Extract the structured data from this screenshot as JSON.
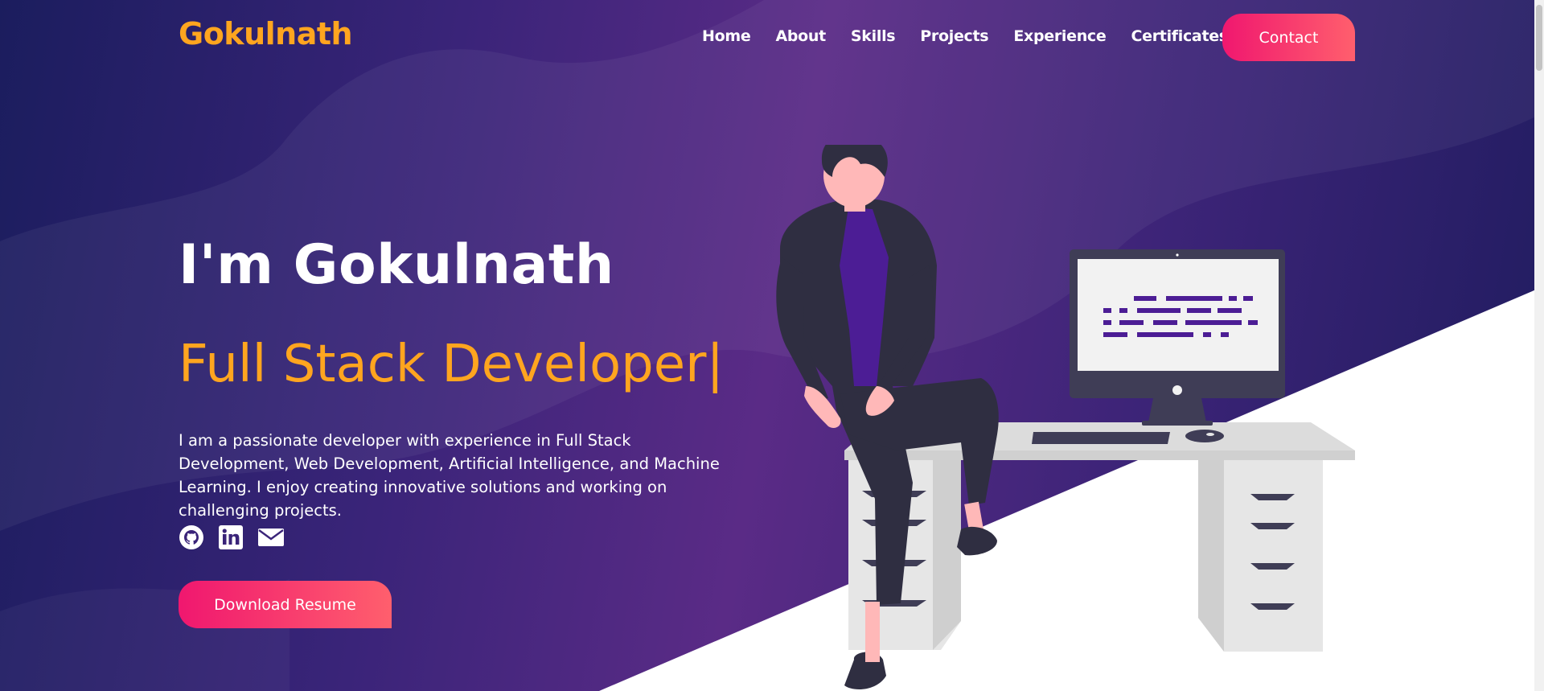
{
  "nav": {
    "brand": "Gokulnath",
    "links": [
      "Home",
      "About",
      "Skills",
      "Projects",
      "Experience",
      "Certificates"
    ],
    "contact_label": "Contact"
  },
  "hero": {
    "title": "I'm Gokulnath",
    "subtitle": "Full Stack Developer|",
    "description": "I am a passionate developer with experience in Full Stack Development, Web Development, Artificial Intelligence, and Machine Learning. I enjoy creating innovative solutions and working on challenging projects.",
    "resume_label": "Download Resume",
    "social_icons": [
      "github-icon",
      "linkedin-icon",
      "email-icon"
    ]
  },
  "colors": {
    "accent_orange": "#ffa51f",
    "button_gradient_start": "#f0176f",
    "button_gradient_end": "#ff5f6d",
    "background_purple": "#4a2780",
    "text_white": "#ffffff"
  }
}
